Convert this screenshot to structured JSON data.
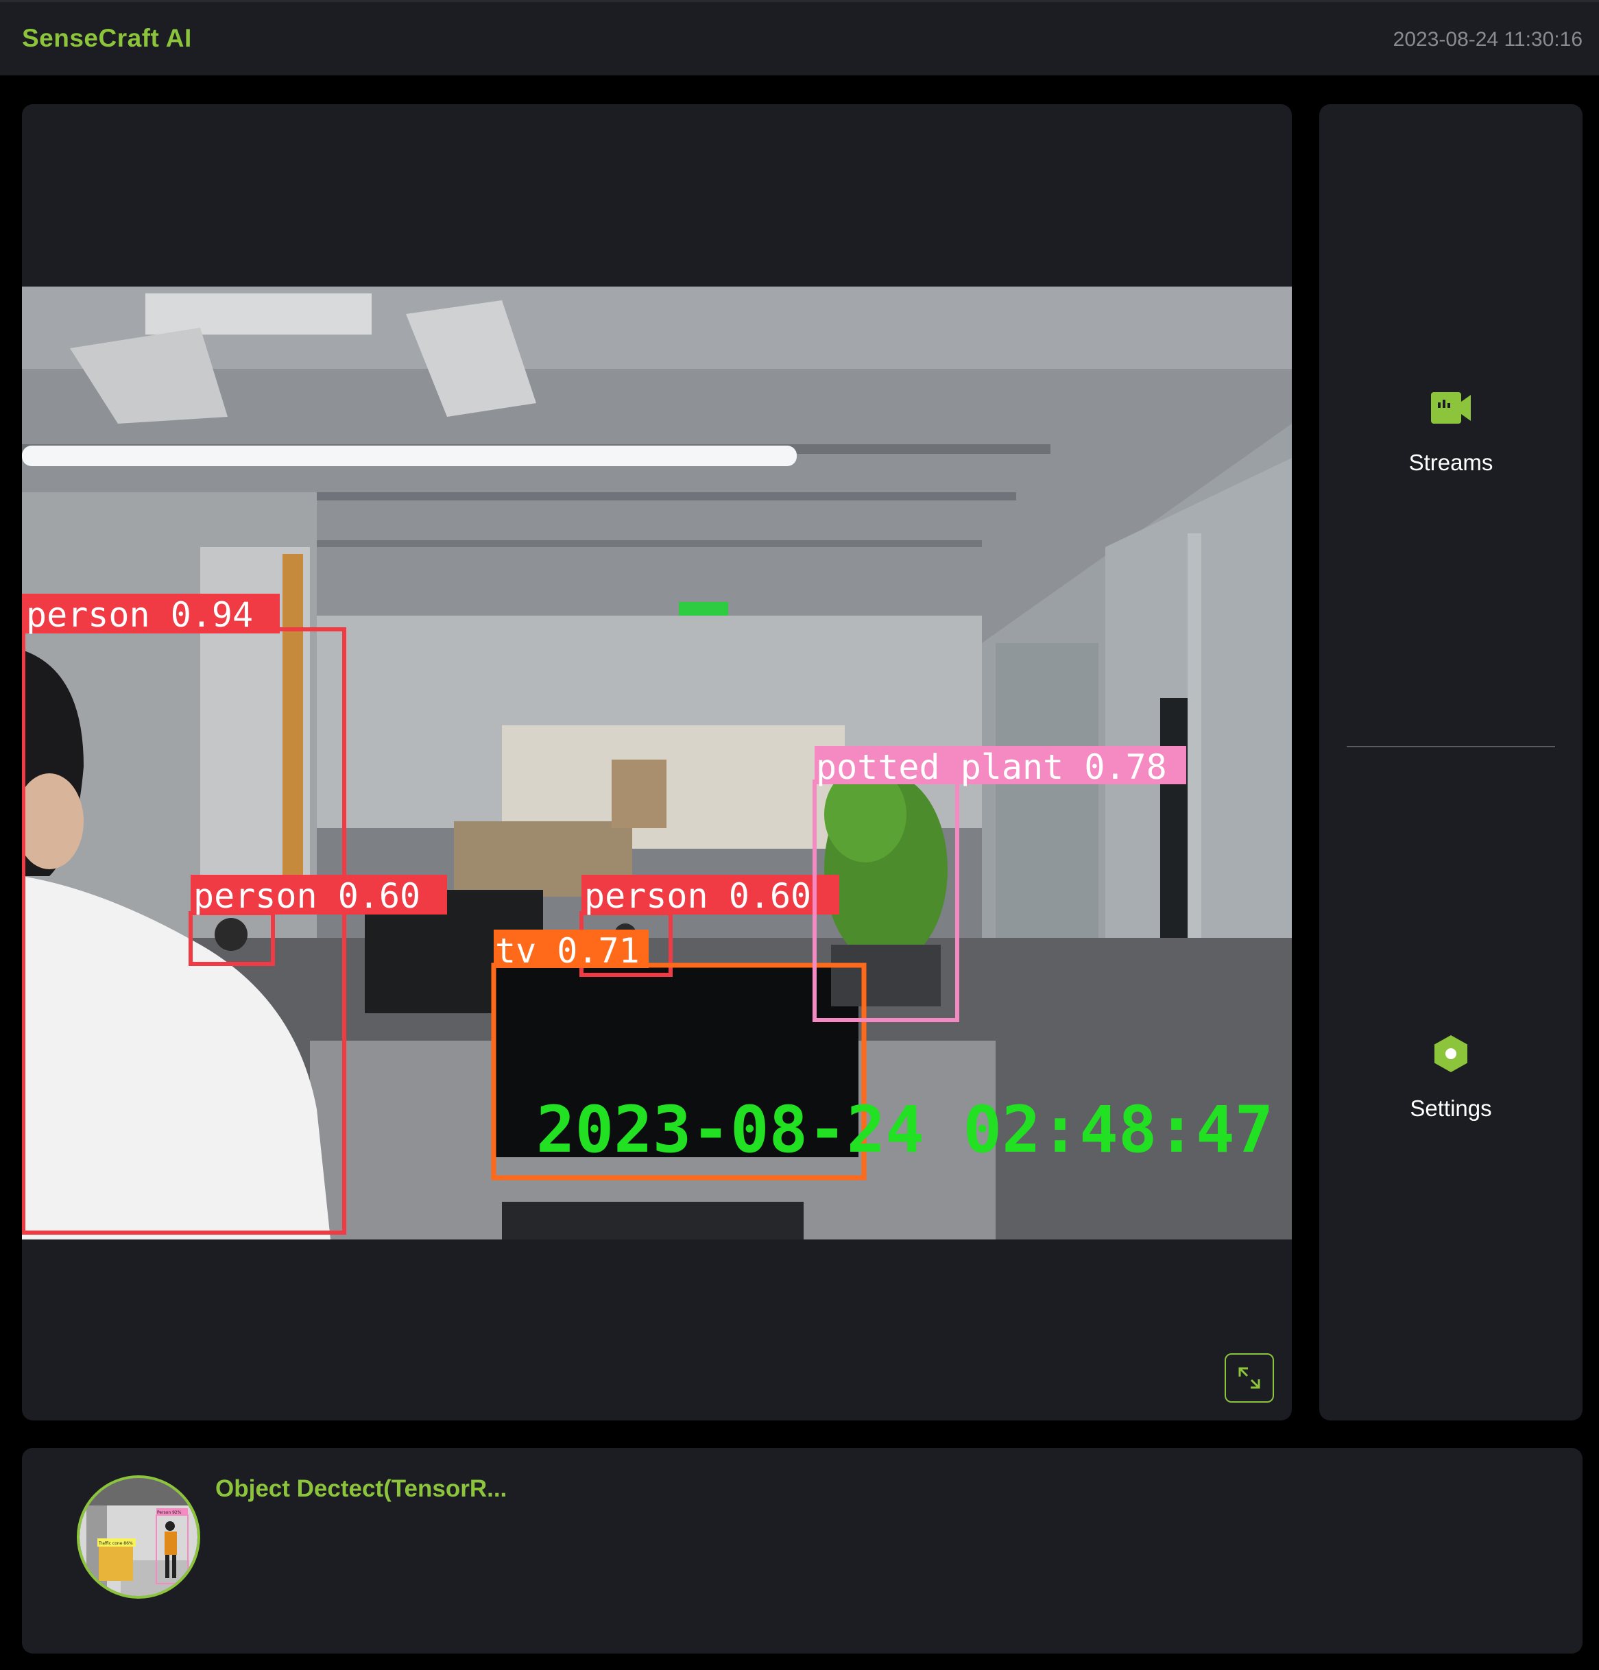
{
  "header": {
    "brand": "SenseCraft AI",
    "datetime": "2023-08-24 11:30:16"
  },
  "video": {
    "overlay_timestamp": "2023-08-24 02:48:47",
    "detections": [
      {
        "label": "person 0.94",
        "color": "#f03a44"
      },
      {
        "label": "person 0.60",
        "color": "#f03a44"
      },
      {
        "label": "person 0.60",
        "color": "#f03a44"
      },
      {
        "label": "tv 0.71",
        "color": "#ff6a1a"
      },
      {
        "label": "potted plant 0.78",
        "color": "#f58ac2"
      }
    ],
    "expand_icon": "expand-icon"
  },
  "sidebar": {
    "items": [
      {
        "label": "Streams",
        "icon": "video-camera-icon"
      },
      {
        "label": "Settings",
        "icon": "settings-hexagon-icon"
      }
    ]
  },
  "app": {
    "title": "Object Dectect(TensorR...",
    "thumb_labels": [
      "Person 92%",
      "Traffic cone 86%"
    ]
  },
  "colors": {
    "accent": "#8cc43c",
    "panel": "#1c1d22",
    "background": "#000000",
    "overlay_text": "#22e022"
  }
}
